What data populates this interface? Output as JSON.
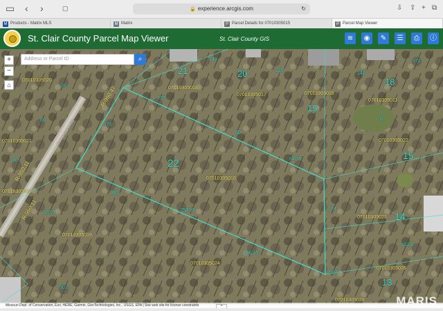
{
  "browser": {
    "url": "experience.arcgis.com",
    "tabs": [
      {
        "label": "Products - Matrix MLS",
        "favicon": "M",
        "color": "#1f4e9a"
      },
      {
        "label": "Matrix",
        "favicon": "M",
        "color": "#6a7a8a"
      },
      {
        "label": "Parcel Details for 07010305015",
        "favicon": "P",
        "color": "#707070"
      },
      {
        "label": "Parcel Map Viewer",
        "favicon": "P",
        "color": "#707070",
        "active": true
      }
    ]
  },
  "header": {
    "title": "St. Clair County Parcel Map Viewer",
    "subtitle": "St. Clair County GIS",
    "bg_color": "#1e6b34",
    "button_color": "#2e7ad6",
    "buttons": [
      "layers-icon",
      "visibility-icon",
      "measure-icon",
      "list-icon",
      "print-icon",
      "info-icon"
    ]
  },
  "search": {
    "placeholder": "Address or Parcel ID",
    "button_icon": "search-icon"
  },
  "map_controls": {
    "zoom_in": "+",
    "zoom_out": "−",
    "home_icon": "home-icon"
  },
  "map": {
    "parcel_line_color": "#40e0d0",
    "label_color": "#f4e36a",
    "lot_numbers": [
      "20",
      "18",
      "19",
      "21",
      "15",
      "22",
      "14",
      "13"
    ],
    "parcel_ids": [
      "07010305018",
      "07010305017",
      "07010305018",
      "07010305011",
      "07010305022",
      "07010305023",
      "07010305016",
      "07010305026",
      "07010305024",
      "07010305019",
      "07010305025",
      "07010305021",
      "07010305028",
      "07010305020"
    ],
    "dimensions": [
      "170",
      "84.35",
      "175",
      "185",
      "254.96",
      "256.35",
      "174",
      "68.5",
      "60",
      "140",
      "26",
      "162.8",
      "128.9",
      "149",
      "129",
      "80",
      "60",
      "10",
      "90.6",
      "172"
    ],
    "roads": [
      "R-950.47",
      "R-950.11",
      "R-950.11"
    ],
    "road_name": "Cornerstone Rd"
  },
  "attribution": "Missouri Dept. of Conservation, Esri, HERE, Garmin, GeoTechnologies, Inc., USGS, EPA | See web site for license constraints",
  "watermark": "MARIS"
}
